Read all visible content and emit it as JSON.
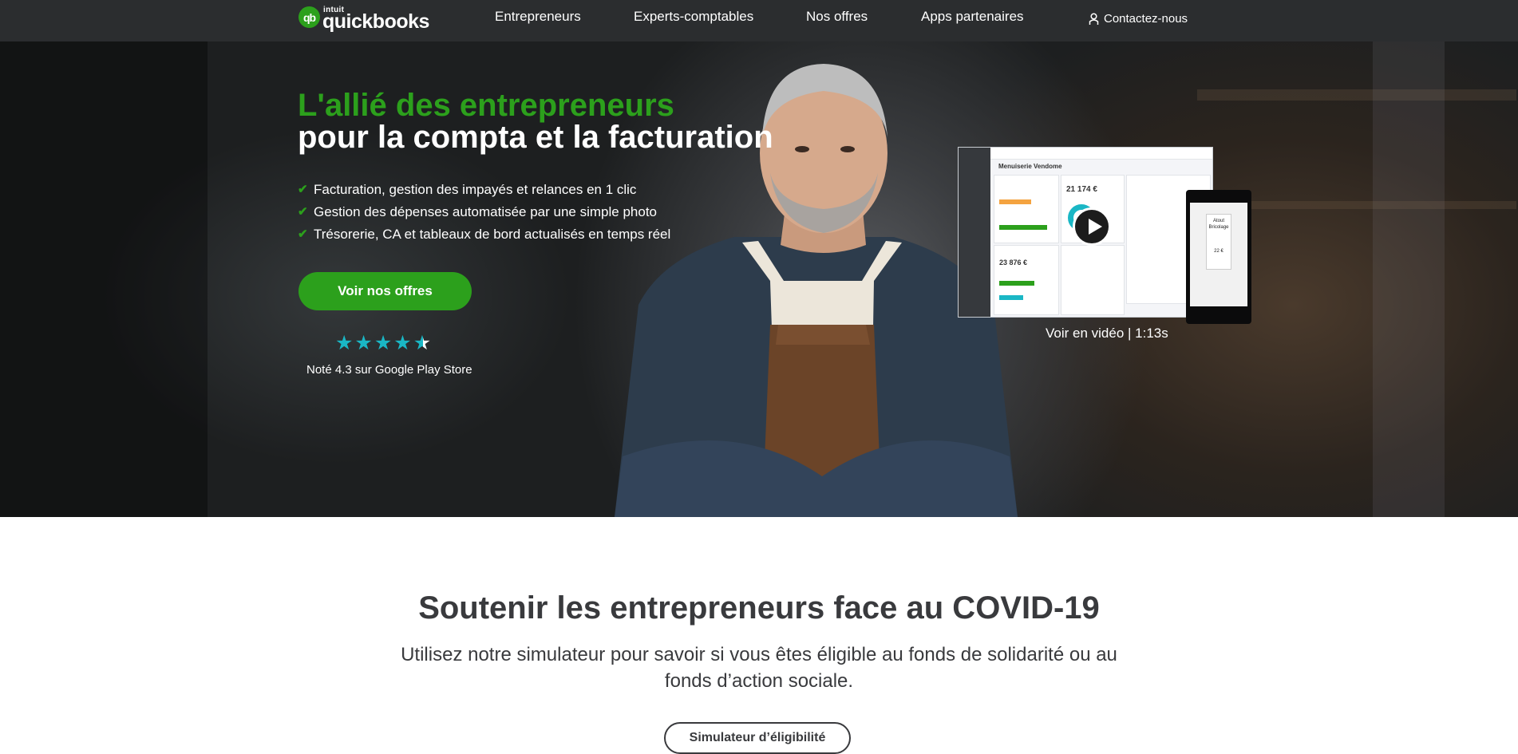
{
  "nav": {
    "logo_badge": "qb",
    "logo_intuit": "intuit",
    "logo_name": "quickbooks",
    "links": [
      "Entrepreneurs",
      "Experts-comptables",
      "Nos offres",
      "Apps partenaires"
    ],
    "contact": "Contactez-nous"
  },
  "hero": {
    "title_green": "L'allié des entrepreneurs",
    "title_white": "pour la compta et la facturation",
    "bullets": [
      "Facturation, gestion des impayés et relances en 1 clic",
      "Gestion des dépenses automatisée par une simple photo",
      "Trésorerie, CA et tableaux de bord actualisés en temps réel"
    ],
    "cta": "Voir nos offres",
    "rating_stars": 4.3,
    "rating_text": "Noté 4.3 sur Google Play Store",
    "video_label": "Voir en vidéo | 1:13s",
    "preview": {
      "company": "Menuiserie Vendome",
      "amount_main": "21 174 €",
      "amount_result": "23 876 €",
      "receipt_title": "Atout Bricolage",
      "receipt_amount": "22 €"
    }
  },
  "covid": {
    "title": "Soutenir les entrepreneurs face au COVID-19",
    "text": "Utilisez notre simulateur pour savoir si vous êtes éligible au fonds de solidarité ou au fonds d’action sociale.",
    "button": "Simulateur d’éligibilité"
  },
  "colors": {
    "brand_green": "#2ca01c",
    "nav_bg": "#2b2d2f",
    "star": "#1ab7c5",
    "text_dark": "#393a3d"
  }
}
